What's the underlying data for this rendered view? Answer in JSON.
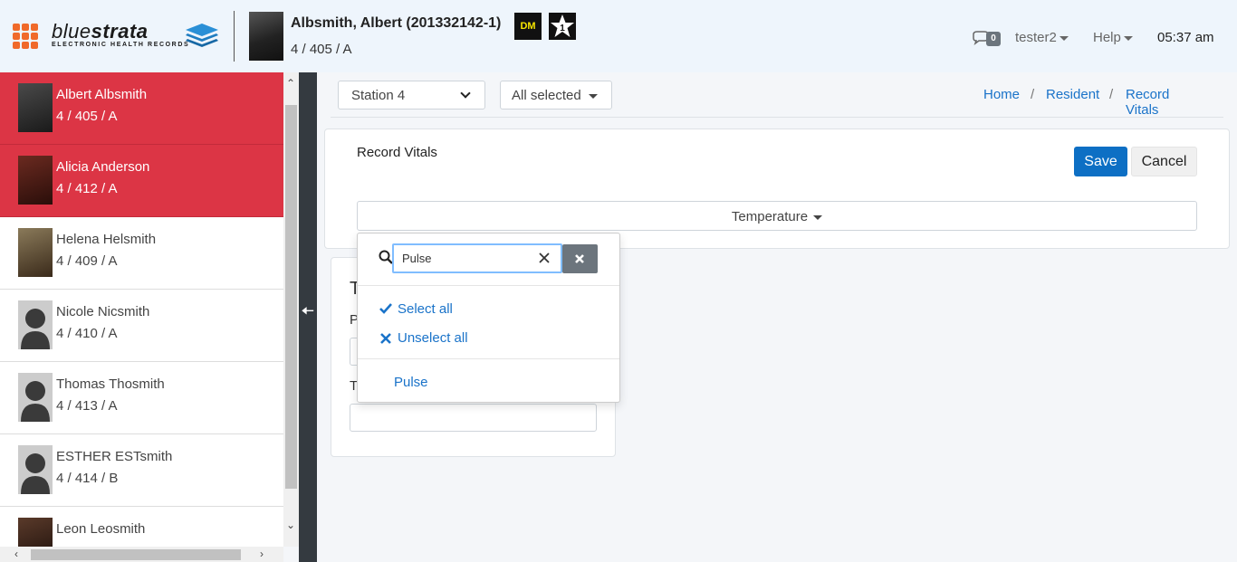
{
  "header": {
    "logo": {
      "word_light": "blue",
      "word_bold": "strata",
      "subtitle": "ELECTRONIC HEALTH RECORDS"
    },
    "patient": {
      "name": "Albsmith, Albert (201332142-1)",
      "location": "4 / 405 / A"
    },
    "badges": {
      "dm": "DM",
      "star": "1"
    },
    "messages_count": "0",
    "user": "tester2",
    "help": "Help",
    "time": "05:37 am"
  },
  "sidebar": {
    "residents": [
      {
        "name": "Albert Albsmith",
        "location": "4 / 405 / A",
        "active": true
      },
      {
        "name": "Alicia Anderson",
        "location": "4 / 412 / A",
        "active": true
      },
      {
        "name": "Helena Helsmith",
        "location": "4 / 409 / A",
        "active": false
      },
      {
        "name": "Nicole Nicsmith",
        "location": "4 / 410 / A",
        "active": false
      },
      {
        "name": "Thomas Thosmith",
        "location": "4 / 413 / A",
        "active": false
      },
      {
        "name": "ESTHER ESTsmith",
        "location": "4 / 414 / B",
        "active": false
      },
      {
        "name": "Leon Leosmith",
        "location": "",
        "active": false
      }
    ]
  },
  "toolbar": {
    "station": "Station 4",
    "filter": "All selected"
  },
  "breadcrumb": {
    "items": [
      "Home",
      "Resident",
      "Record Vitals"
    ],
    "separator": "/"
  },
  "card": {
    "title": "Record Vitals",
    "save_label": "Save",
    "cancel_label": "Cancel",
    "vital_select": "Temperature"
  },
  "lower_card": {
    "heading": "T",
    "label1": "P",
    "label2": "T"
  },
  "dropdown": {
    "search_value": "Pulse",
    "select_all": "Select all",
    "unselect_all": "Unselect all",
    "options": [
      "Pulse"
    ]
  },
  "colors": {
    "active_row": "#dc3545",
    "link": "#1a73c9",
    "primary": "#0d6fc4",
    "header_bg": "#eef5fc",
    "apps_icon": "#f06a2a"
  },
  "icons": [
    "apps-grid-icon",
    "stack-logo-icon",
    "comment-icon",
    "search-icon",
    "clear-icon",
    "close-icon",
    "check-icon",
    "x-icon",
    "chevron-down-icon",
    "arrow-left-icon"
  ]
}
